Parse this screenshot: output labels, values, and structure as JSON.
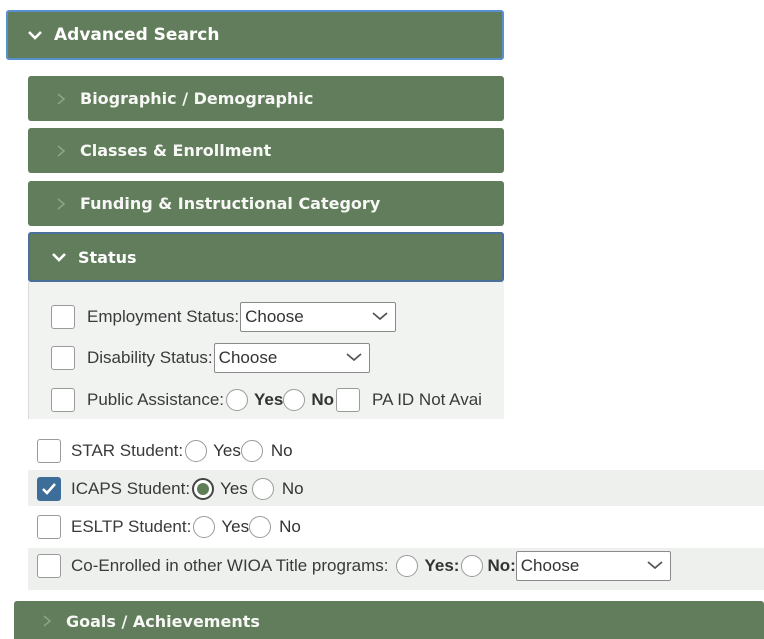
{
  "advanced_search": {
    "label": "Advanced Search"
  },
  "sections": {
    "biographic": "Biographic / Demographic",
    "classes": "Classes & Enrollment",
    "funding": "Funding & Instructional Category",
    "status": "Status",
    "goals": "Goals / Achievements"
  },
  "status_fields": {
    "employment": {
      "label": "Employment Status:",
      "value": "Choose"
    },
    "disability": {
      "label": "Disability Status:",
      "value": "Choose"
    },
    "public_assistance": {
      "label": "Public Assistance:",
      "yes": "Yes",
      "no": "No",
      "pa_id": "PA ID Not Avai"
    }
  },
  "students": {
    "star": {
      "label": "STAR Student:",
      "yes": "Yes",
      "no": "No",
      "checked": false
    },
    "icaps": {
      "label": "ICAPS Student:",
      "yes": "Yes",
      "no": "No",
      "checked": true,
      "selected": "Yes"
    },
    "esltp": {
      "label": "ESLTP Student:",
      "yes": "Yes",
      "no": "No",
      "checked": false
    },
    "coenrolled": {
      "label": "Co-Enrolled in other WIOA Title programs:",
      "yes": "Yes:",
      "no": "No:",
      "select_value": "Choose",
      "checked": false
    }
  },
  "colors": {
    "header_green": "#627d5b",
    "focus_blue": "#5a8fce",
    "check_blue": "#3d6d99"
  }
}
